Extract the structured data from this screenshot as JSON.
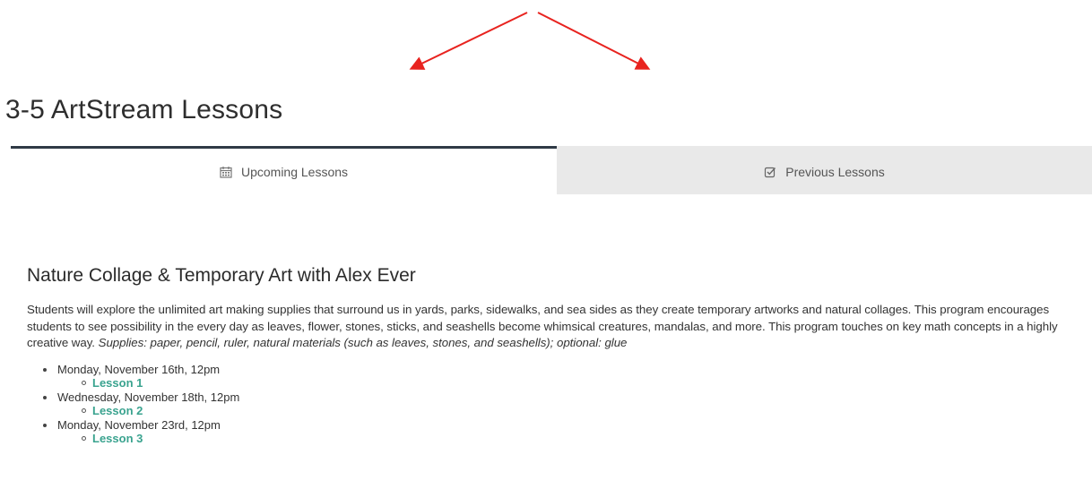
{
  "page": {
    "title": "3-5 ArtStream Lessons"
  },
  "tabs": [
    {
      "label": "Upcoming Lessons",
      "icon": "calendar-icon",
      "active": true
    },
    {
      "label": "Previous Lessons",
      "icon": "checkbox-icon",
      "active": false
    }
  ],
  "lesson": {
    "title": "Nature Collage & Temporary Art with Alex Ever",
    "description": "Students will explore the unlimited art making supplies that surround us in yards, parks, sidewalks, and sea sides as they create temporary artworks and natural collages. This program encourages students to see possibility in the every day as leaves, flower, stones, sticks, and seashells become whimsical creatures, mandalas, and more. This program touches on key math concepts in a highly creative way.",
    "supplies": "Supplies: paper, pencil, ruler, natural materials (such as leaves, stones, and seashells); optional: glue",
    "sessions": [
      {
        "date": "Monday, November 16th, 12pm",
        "link": "Lesson 1"
      },
      {
        "date": "Wednesday, November 18th, 12pm",
        "link": "Lesson 2"
      },
      {
        "date": "Monday, November 23rd, 12pm",
        "link": "Lesson 3"
      }
    ]
  },
  "colors": {
    "arrow": "#e8231f",
    "link": "#3aa38f",
    "active_tab_border": "#2f3a46",
    "inactive_tab_bg": "#e9e9e9"
  }
}
